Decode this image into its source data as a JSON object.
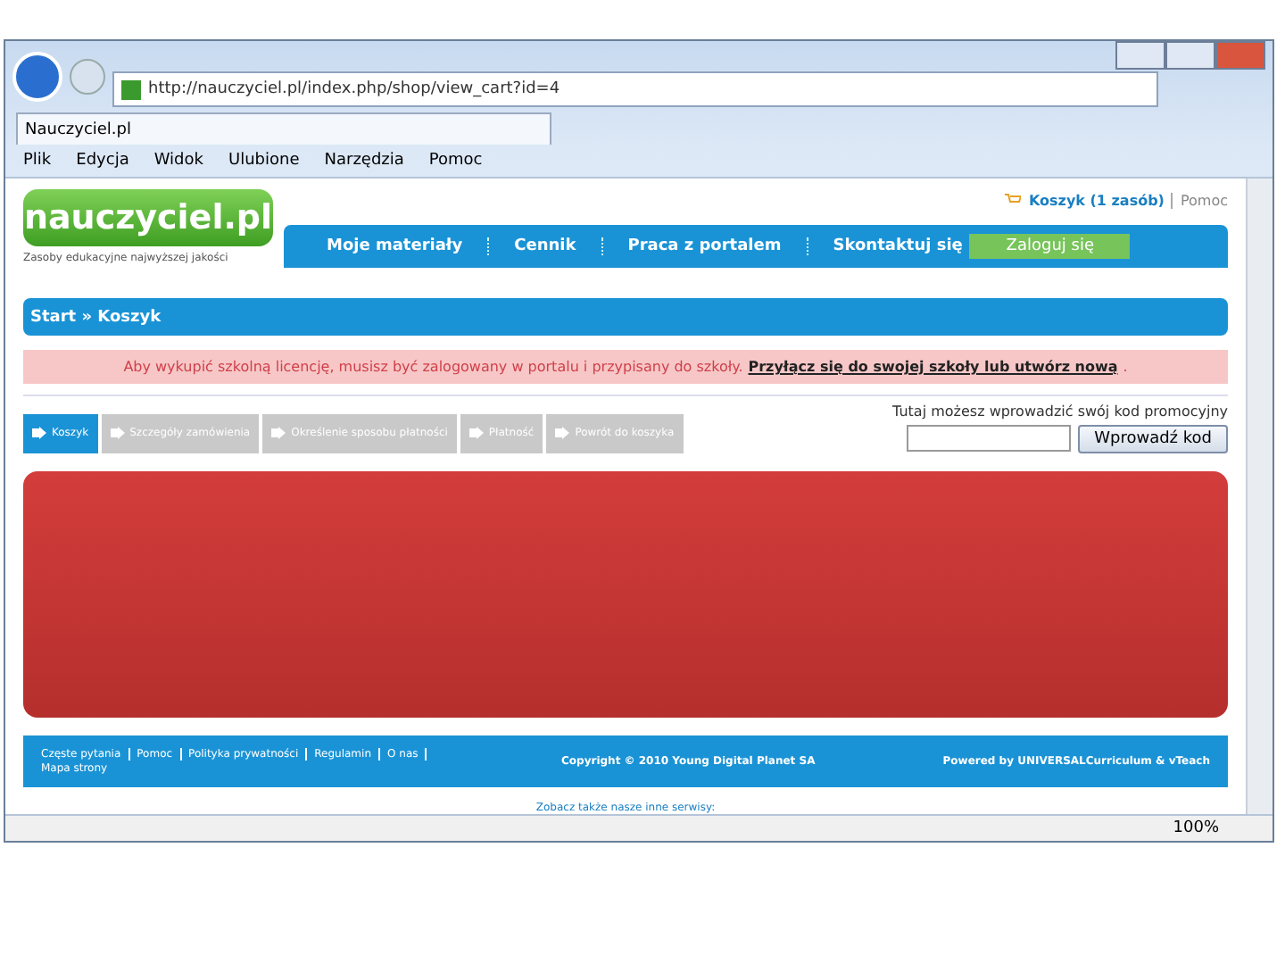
{
  "browser": {
    "address": "http://nauczyciel.pl/index.php/shop/view_cart?id=4",
    "tab_title": "Nauczyciel.pl",
    "menu": [
      "Plik",
      "Edycja",
      "Widok",
      "Ulubione",
      "Narzędzia",
      "Pomoc"
    ],
    "zoom": "100%"
  },
  "header": {
    "logo": "nauczyciel.pl",
    "tagline": "Zasoby edukacyjne najwyższej jakości",
    "cart": "Koszyk (1 zasób)",
    "help": "Pomoc",
    "nav": [
      "Moje materiały",
      "Cennik",
      "Praca z portalem",
      "Skontaktuj się"
    ],
    "login": "Zaloguj się"
  },
  "breadcrumb": "Start » Koszyk",
  "alert": {
    "message": "Aby wykupić szkolną licencję, musisz być zalogowany w portalu i przypisany do szkoły.",
    "link": "Przyłącz się do swojej szkoły lub utwórz nową",
    "end": "."
  },
  "steps": [
    {
      "label": "Koszyk",
      "selected": true
    },
    {
      "label": "Szczegóły zamówienia",
      "selected": false
    },
    {
      "label": "Określenie sposobu płatności",
      "selected": false
    },
    {
      "label": "Płatność",
      "selected": false
    },
    {
      "label": "Powrót do koszyka",
      "selected": false
    }
  ],
  "promo": {
    "label": "Tutaj możesz wprowadzić swój kod promocyjny",
    "button": "Wprowadź kod"
  },
  "footer": {
    "links": [
      "Częste pytania",
      "Pomoc",
      "Polityka prywatności",
      "Regulamin",
      "O nas",
      "Mapa strony"
    ],
    "copyright": "Copyright © 2010 Young Digital Planet SA",
    "powered": "Powered by UNIVERSALCurriculum & vTeach",
    "other": "Zobacz także nasze inne serwisy:"
  }
}
